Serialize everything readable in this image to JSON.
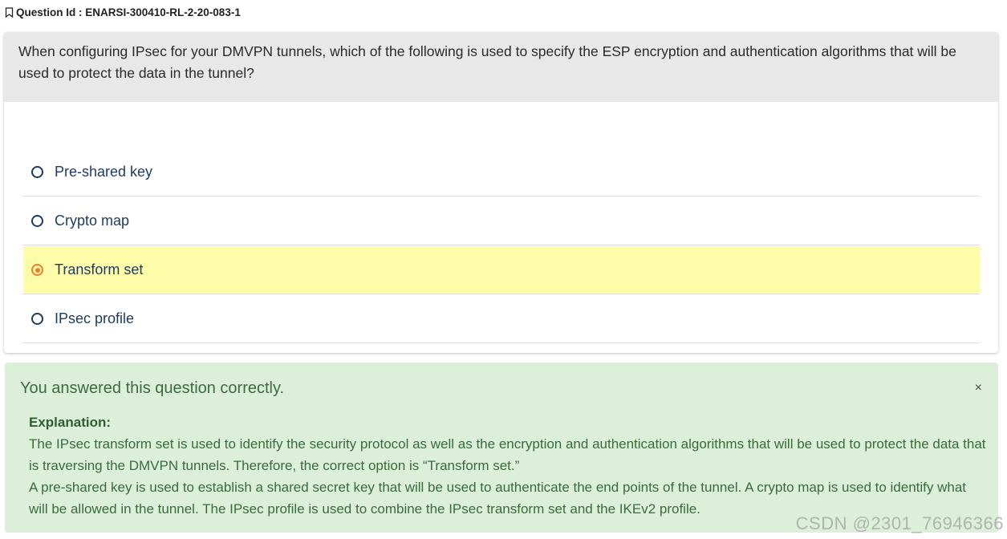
{
  "question_id": "Question Id : ENARSI-300410-RL-2-20-083-1",
  "question_text": "When configuring IPsec for your DMVPN tunnels, which of the following is used to specify the ESP encryption and authentication algorithms that will be used to protect the data in the tunnel?",
  "options": [
    {
      "label": "Pre-shared key",
      "selected": false
    },
    {
      "label": "Crypto map",
      "selected": false
    },
    {
      "label": "Transform set",
      "selected": true
    },
    {
      "label": "IPsec profile",
      "selected": false
    }
  ],
  "result": {
    "title": "You answered this question correctly.",
    "close_label": "×",
    "explanation_heading": "Explanation:",
    "explanation_p1": "The IPsec transform set is used to identify the security protocol as well as the encryption and authentication algorithms that will be used to protect the data that is traversing the DMVPN tunnels. Therefore, the correct option is “Transform set.”",
    "explanation_p2": "A pre-shared key is used to establish a shared secret key that will be used to authenticate the end points of the tunnel. A crypto map is used to identify what will be allowed in the tunnel. The IPsec profile is used to combine the IPsec transform set and the IKEv2 profile."
  },
  "watermark": "CSDN @2301_76946366",
  "colors": {
    "selected_bg": "#fdfdaa",
    "radio_selected": "#f07d2a",
    "success_bg": "#dcefd9",
    "question_bg": "#e8e8e8"
  },
  "icons": {
    "bookmark": "bookmark-icon"
  }
}
